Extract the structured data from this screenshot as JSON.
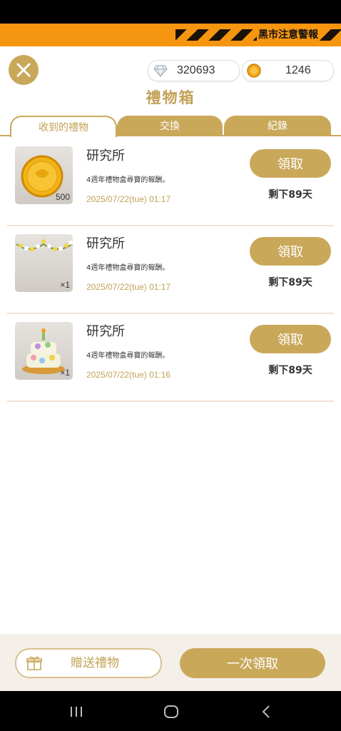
{
  "warning": {
    "text": "黑市注意警報"
  },
  "currency": {
    "diamonds": "320693",
    "coins": "1246"
  },
  "title": "禮物箱",
  "tabs": [
    {
      "label": "收到的禮物",
      "active": true
    },
    {
      "label": "交換",
      "active": false
    },
    {
      "label": "紀錄",
      "active": false
    }
  ],
  "gifts": [
    {
      "name": "研究所",
      "description": "4週年禮物盒尋寶的報酬。",
      "date": "2025/07/22(tue) 01:17",
      "quantity": "500",
      "claim_label": "領取",
      "remaining": "剩下89天",
      "icon": "gold-coin-icon"
    },
    {
      "name": "研究所",
      "description": "4週年禮物盒尋寶的報酬。",
      "date": "2025/07/22(tue) 01:17",
      "quantity": "×1",
      "claim_label": "領取",
      "remaining": "剩下89天",
      "icon": "flower-garland-icon"
    },
    {
      "name": "研究所",
      "description": "4週年禮物盒尋寶的報酬。",
      "date": "2025/07/22(tue) 01:16",
      "quantity": "×1",
      "claim_label": "領取",
      "remaining": "剩下89天",
      "icon": "anniversary-cake-icon"
    }
  ],
  "footer": {
    "send_label": "贈送禮物",
    "claim_all_label": "一次領取"
  },
  "colors": {
    "accent": "#c9a85a",
    "warning_bar": "#f6950f",
    "footer_bg": "#f4efe9",
    "date_text": "#c2a256"
  }
}
